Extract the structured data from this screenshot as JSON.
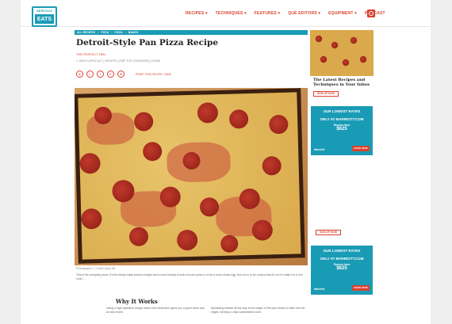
{
  "logo": {
    "top": "SERIOUS",
    "bottom": "EATS"
  },
  "nav": [
    "RECIPES ▾",
    "TECHNIQUES ▾",
    "FEATURES ▾",
    "QUE EDITORS ▾",
    "EQUIPMENT ▾",
    "PODCAST"
  ],
  "breadcrumb": [
    "ALL RECIPES",
    "›",
    "PIZZA",
    "›",
    "PIZZA",
    "›",
    "BAKED"
  ],
  "article": {
    "title": "Detroit-Style Pan Pizza Recipe",
    "subtitle": "THE PERFECT PAN",
    "byline": "J. KENJI LÓPEZ-ALT  |  RECIPES  |  [SEE THE COOKBOOK]  |  HOME",
    "social_label": "PRINT THIS RECIPE / SAVE",
    "caption": "Photographs: J. Kenji López-Alt",
    "body": "This is the everyday pizza. It's the easily-made pizza in height and a more bready crumb of a pan pizza or to be a more whole-egg. But not in to be a pizza that it's so it's really it is a rich crust ...",
    "why_heading": "Why It Works",
    "why_left": "Using a high-hydration dough made with bread flour gives you a good chew and an airy crumb.",
    "why_right": "Spreading cheese all the way to the edges of the pan means it melts into the edges, forming a crisp caramelized crust."
  },
  "sidebar": {
    "headline": "The Latest Recipes and Techniques in Your Inbox",
    "signup": "SIGN UP NOW",
    "signup2": "SIGN UP NOW",
    "ads": [
      {
        "l1": "OUR LOWEST RATES",
        "l2": "ONLY AT MARRIOTT.COM",
        "price_label": "Rooms from",
        "price": "$625",
        "brand": "Marriott",
        "cta": "BOOK NOW"
      },
      {
        "l1": "OUR LOWEST RATES",
        "l2": "ONLY AT MARRIOTT.COM",
        "price_label": "Rooms from",
        "price": "$625",
        "brand": "Marriott",
        "cta": "BOOK NOW"
      }
    ]
  },
  "social_icons": [
    "♥",
    "f",
    "t",
    "P",
    "✉"
  ]
}
